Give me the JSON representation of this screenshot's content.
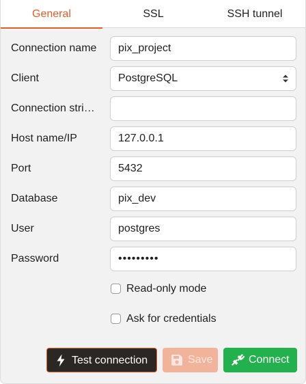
{
  "tabs": [
    {
      "label": "General"
    },
    {
      "label": "SSL"
    },
    {
      "label": "SSH tunnel"
    }
  ],
  "fields": {
    "connection_name": {
      "label": "Connection name",
      "value": "pix_project"
    },
    "client": {
      "label": "Client",
      "value": "PostgreSQL"
    },
    "connection_string": {
      "label": "Connection stri…",
      "value": ""
    },
    "host": {
      "label": "Host name/IP",
      "value": "127.0.0.1"
    },
    "port": {
      "label": "Port",
      "value": "5432"
    },
    "database": {
      "label": "Database",
      "value": "pix_dev"
    },
    "user": {
      "label": "User",
      "value": "postgres"
    },
    "password": {
      "label": "Password",
      "value": "•••••••••"
    }
  },
  "options": {
    "read_only": {
      "label": "Read-only mode",
      "checked": false
    },
    "ask_credentials": {
      "label": "Ask for credentials",
      "checked": false
    }
  },
  "buttons": {
    "test": {
      "label": "Test connection",
      "icon": "lightning-icon"
    },
    "save": {
      "label": "Save",
      "icon": "floppy-disk-icon"
    },
    "connect": {
      "label": "Connect",
      "icon": "plug-icon"
    }
  },
  "colors": {
    "accent": "#e35d2a",
    "connect": "#22b14c",
    "save_disabled": "#f2b39b",
    "test_bg": "#2a2725"
  }
}
